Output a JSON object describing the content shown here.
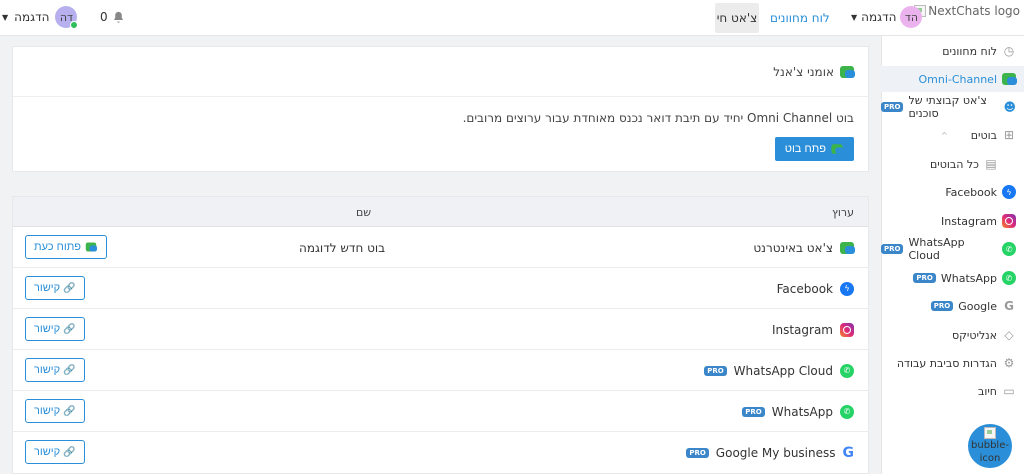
{
  "header": {
    "logo_alt": "NextChats logo",
    "user_name": "הדגמה",
    "user_initials": "הד",
    "nav_dashboard": "לוח מחוונים",
    "nav_live_chat": "צ'אט חי",
    "notifications_count": "0",
    "agent_name": "הדגמה",
    "agent_initials": "דה"
  },
  "sidebar": {
    "items": [
      {
        "label": "לוח מחוונים",
        "icon": "dashboard-icon"
      },
      {
        "label": "Omni-Channel",
        "icon": "omnichannel-icon"
      },
      {
        "label": "צ'אט קבוצתי של סוכנים",
        "icon": "agents-icon",
        "badge": "PRO"
      },
      {
        "label": "בוטים",
        "icon": "bots-icon"
      },
      {
        "label": "כל הבוטים",
        "icon": "list-icon"
      },
      {
        "label": "Facebook",
        "icon": "messenger-icon"
      },
      {
        "label": "Instagram",
        "icon": "instagram-icon"
      },
      {
        "label": "WhatsApp Cloud",
        "icon": "whatsapp-icon",
        "badge": "PRO"
      },
      {
        "label": "WhatsApp",
        "icon": "whatsapp-icon",
        "badge": "PRO"
      },
      {
        "label": "Google",
        "icon": "google-icon",
        "badge": "PRO"
      },
      {
        "label": "אנליטיקס",
        "icon": "analytics-icon"
      },
      {
        "label": "הגדרות סביבת עבודה",
        "icon": "settings-icon"
      },
      {
        "label": "חיוב",
        "icon": "billing-icon"
      }
    ],
    "bubble_alt": "bubble-icon"
  },
  "omni": {
    "title": "אומני צ'אנל",
    "description": "בוט Omni Channel יחיד עם תיבת דואר נכנס מאוחדת עבור ערוצים מרובים.",
    "open_bot_button": "פתח בוט"
  },
  "table": {
    "col_channel": "ערוץ",
    "col_name": "שם",
    "rows": [
      {
        "channel": "צ'אט באינטרנט",
        "name": "בוט חדש לדוגמה",
        "action": "פתוח כעת",
        "icon": "webchat-icon"
      },
      {
        "channel": "Facebook",
        "name": "",
        "action": "קישור",
        "icon": "messenger-icon"
      },
      {
        "channel": "Instagram",
        "name": "",
        "action": "קישור",
        "icon": "instagram-icon"
      },
      {
        "channel": "WhatsApp Cloud",
        "name": "",
        "action": "קישור",
        "icon": "whatsapp-icon",
        "badge": "PRO"
      },
      {
        "channel": "WhatsApp",
        "name": "",
        "action": "קישור",
        "icon": "whatsapp-icon",
        "badge": "PRO"
      },
      {
        "channel": "Google My business",
        "name": "",
        "action": "קישור",
        "icon": "google-icon",
        "badge": "PRO"
      }
    ]
  },
  "colors": {
    "accent": "#2a8fd8",
    "pro_badge": "#3b86c8",
    "whatsapp": "#25d366",
    "messenger": "#1877f2"
  }
}
